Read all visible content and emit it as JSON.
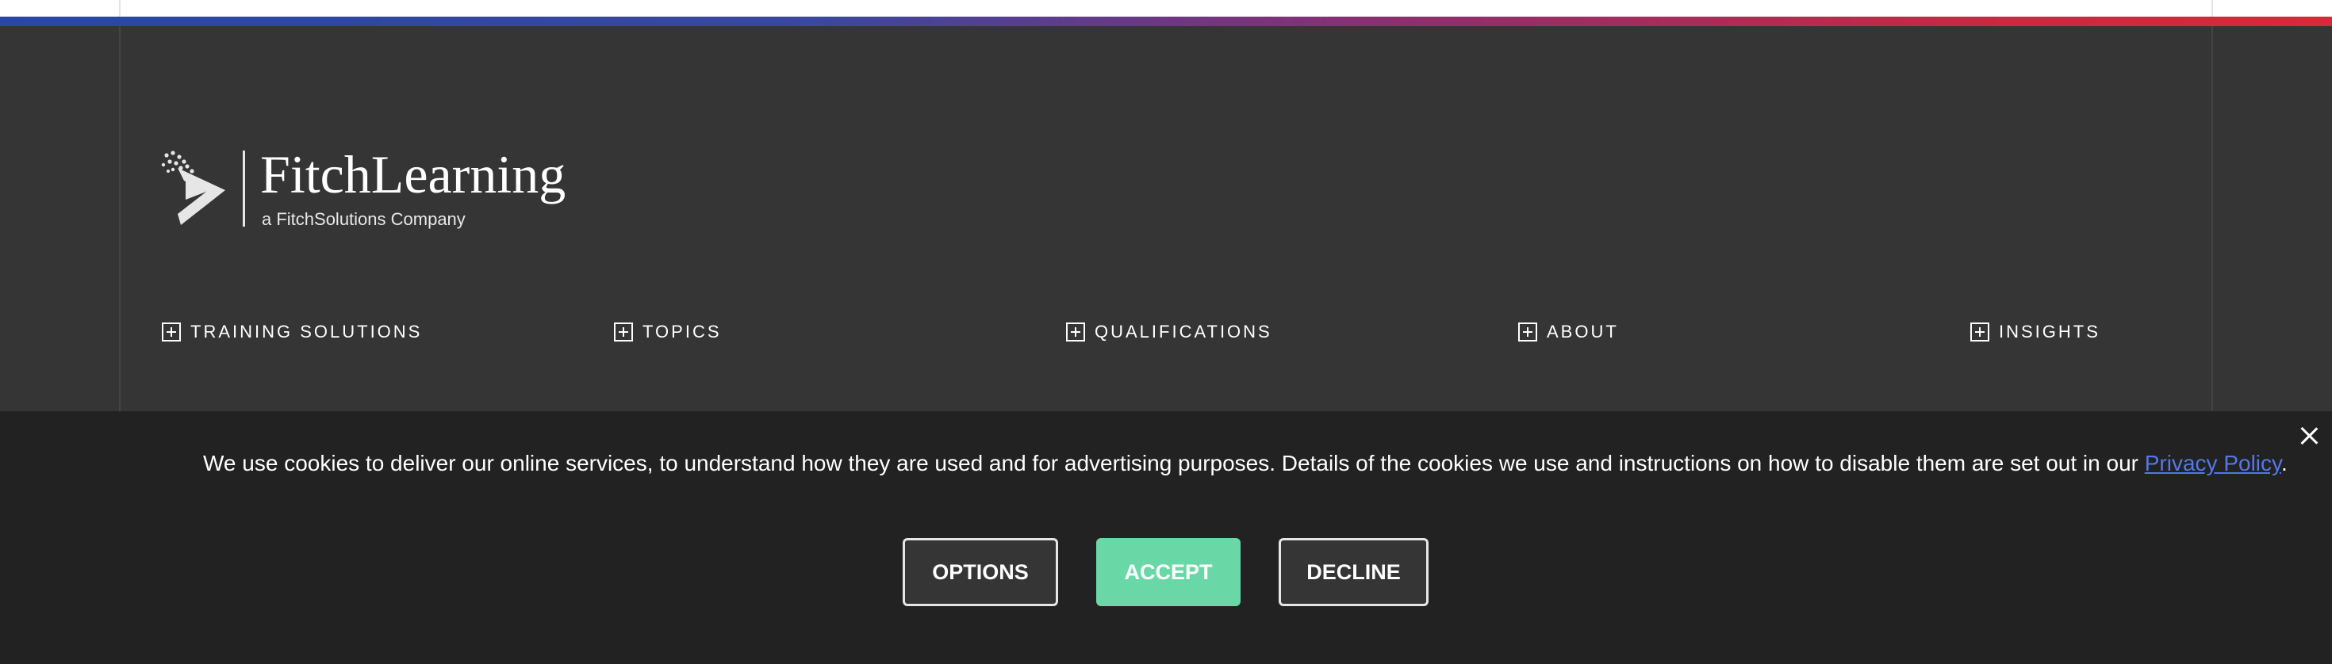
{
  "logo": {
    "name": "FitchLearning",
    "subtitle": "a FitchSolutions Company"
  },
  "nav": {
    "items": [
      {
        "label": "TRAINING SOLUTIONS",
        "icon": "plus-square-icon"
      },
      {
        "label": "TOPICS",
        "icon": "plus-square-icon"
      },
      {
        "label": "QUALIFICATIONS",
        "icon": "plus-square-icon"
      },
      {
        "label": "ABOUT",
        "icon": "plus-square-icon"
      },
      {
        "label": "INSIGHTS",
        "icon": "plus-square-icon"
      }
    ]
  },
  "cookie": {
    "message": "We use cookies to deliver our online services, to understand how they are used and for advertising purposes. Details of the cookies we use and instructions on how to disable them are set out in our ",
    "link_text": "Privacy Policy",
    "message_end": ".",
    "options_label": "OPTIONS",
    "accept_label": "ACCEPT",
    "decline_label": "DECLINE",
    "close_icon": "close-icon"
  },
  "colors": {
    "footer_bg": "#353535",
    "banner_bg": "#222222",
    "accept": "#6ad8a6",
    "link": "#5577e8",
    "gradient_start": "#2946a6",
    "gradient_end": "#d52a3a"
  }
}
